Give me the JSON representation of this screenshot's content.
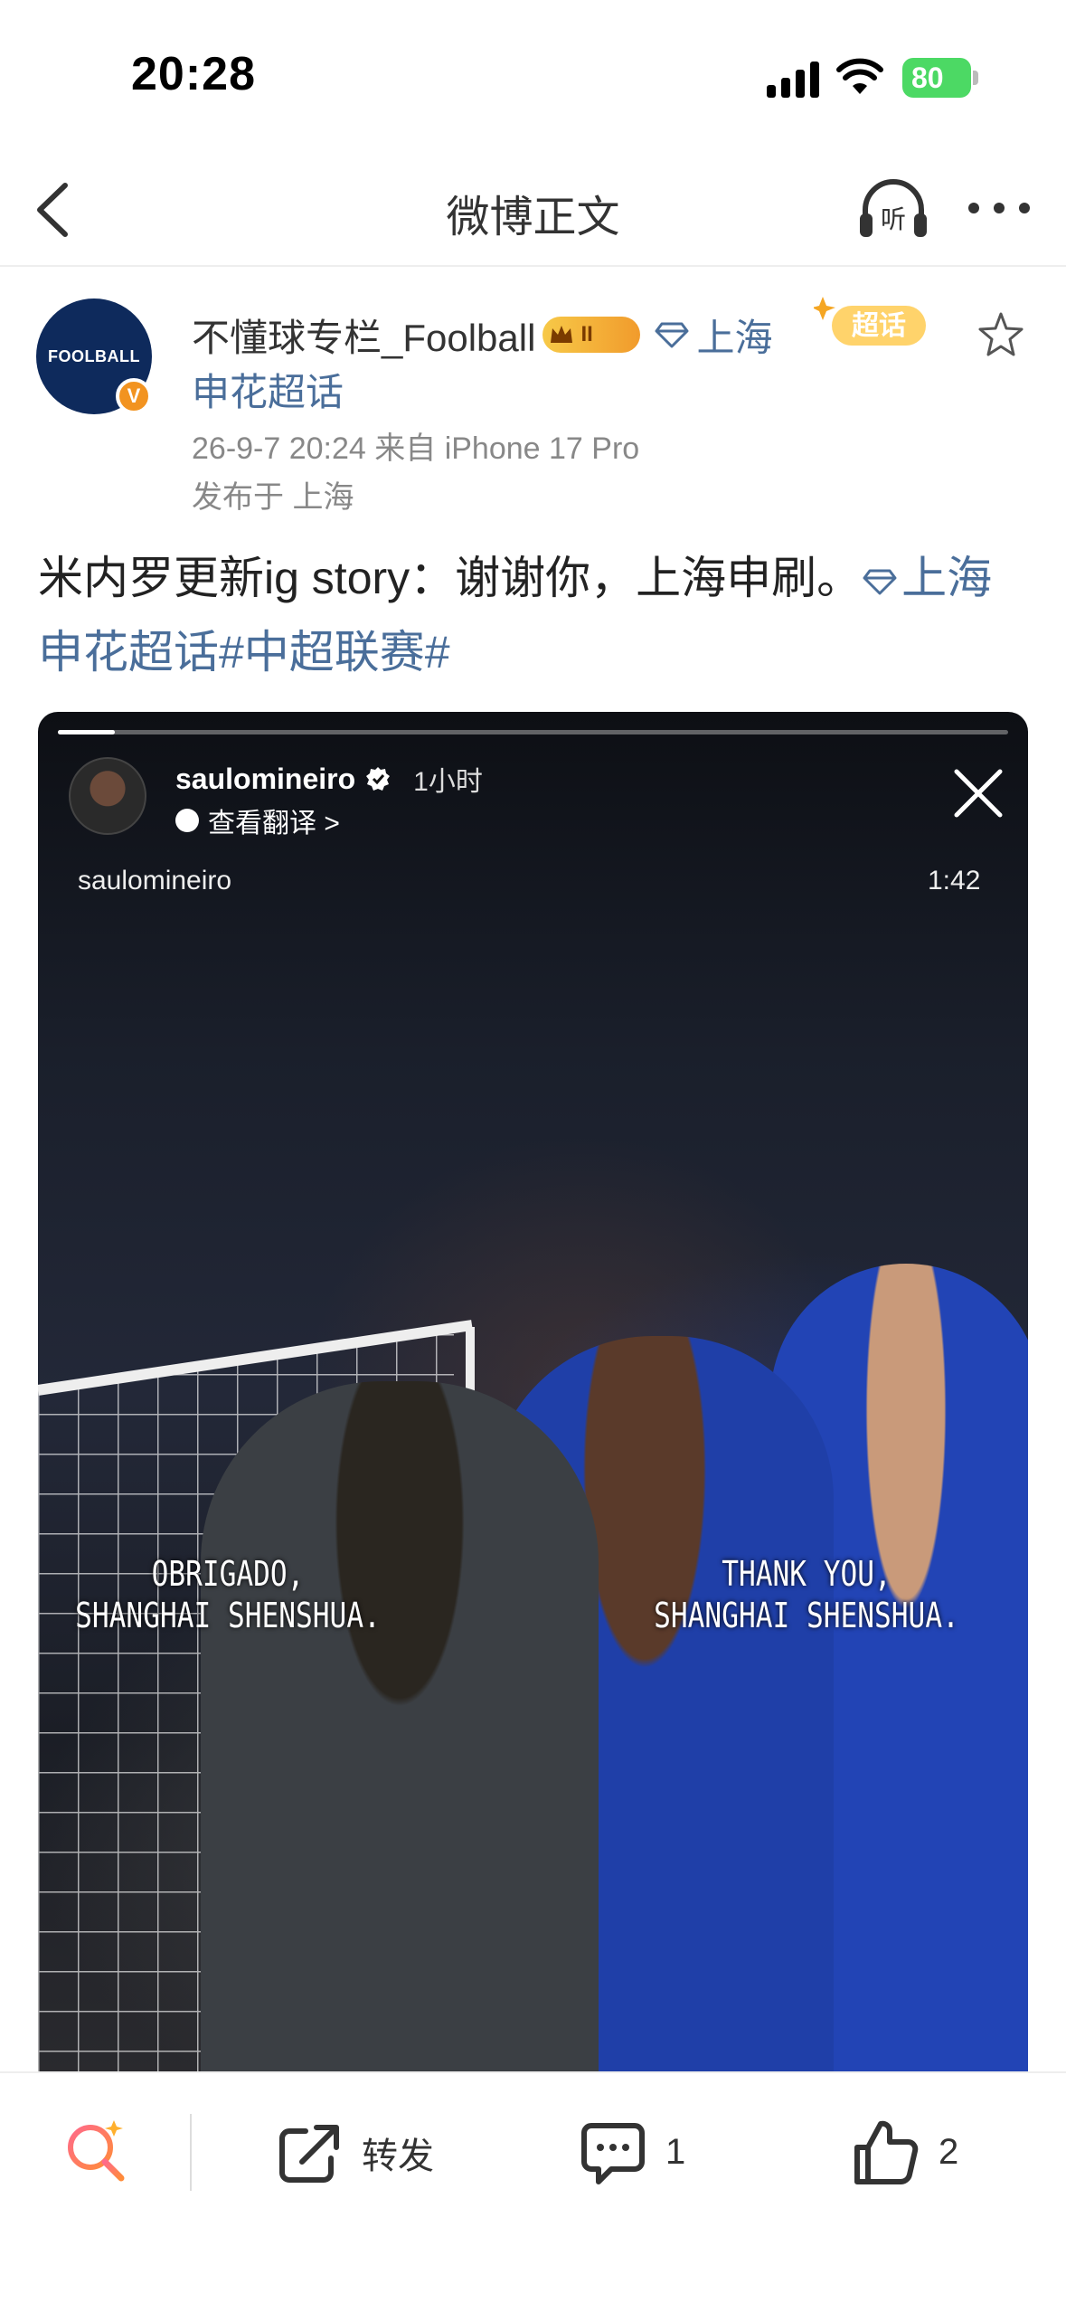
{
  "status_bar": {
    "time": "20:28",
    "battery": "80"
  },
  "nav": {
    "title": "微博正文"
  },
  "author": {
    "avatar_text": "FOOLBALL",
    "verify_mark": "V",
    "name": "不懂球专栏_Foolball",
    "level_badge": "II",
    "location_link": "上海",
    "supertopic_tag": "超话",
    "topic": "申花超话",
    "time_source": "26-9-7 20:24  来自 iPhone 17 Pro",
    "published_in": "发布于 上海"
  },
  "post": {
    "text": "米内罗更新ig story：谢谢你，上海申刷。",
    "link1": "上海申花超话",
    "link2": "#中超联赛#"
  },
  "media": {
    "progress": 0.06,
    "story_user": "saulomineiro",
    "story_time": "1小时",
    "translate_label": "查看翻译 >",
    "video_user": "saulomineiro",
    "video_time": "1:42",
    "caption_left": "OBRIGADO,\nSHANGHAI SHENSHUA.",
    "caption_right": "THANK YOU,\nSHANGHAI SHENSHUA."
  },
  "actions": {
    "repost_label": "转发",
    "comment_count": "1",
    "like_count": "2"
  },
  "colors": {
    "link": "#4a6e9a",
    "accent_orange": "#f29320"
  }
}
